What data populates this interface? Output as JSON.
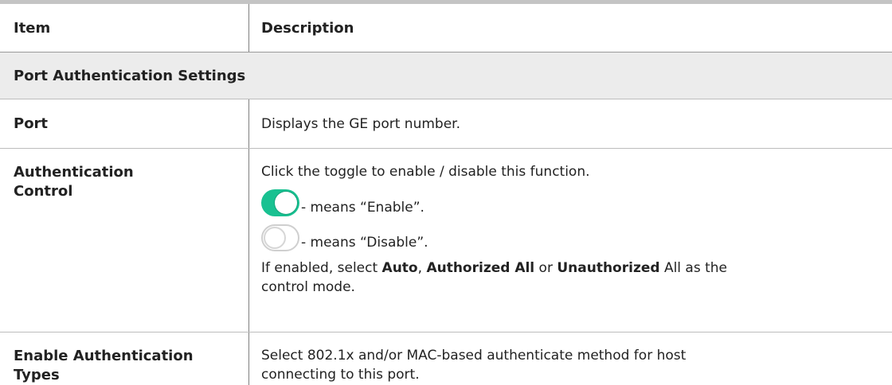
{
  "header": {
    "item": "Item",
    "description": "Description"
  },
  "section_title": "Port Authentication Settings",
  "rows": {
    "port": {
      "item": "Port",
      "description": "Displays the GE port number."
    },
    "auth_control": {
      "item_line1": "Authentication",
      "item_line2": "Control",
      "intro": "Click the toggle to enable / disable this function.",
      "enable_text": "- means “Enable”.",
      "disable_text": "- means “Disable”.",
      "para_prefix": "If enabled, select ",
      "auto": "Auto",
      "sep1": ", ",
      "authorized_all": "Authorized All",
      "sep2": " or ",
      "unauthorized": "Unauthorized",
      "para_suffix_line1": " All as the",
      "para_line2": "control mode."
    },
    "auth_types": {
      "item_line1": "Enable Authentication",
      "item_line2": "Types",
      "desc_line1": "Select 802.1x and/or MAC-based authenticate method for host",
      "desc_line2": "connecting to this port."
    }
  },
  "colors": {
    "toggle_on": "#19c191",
    "toggle_off_border": "#cfcfcf",
    "section_bg": "#ececec"
  },
  "icons": {
    "toggle_on": "toggle-on-icon",
    "toggle_off": "toggle-off-icon"
  }
}
